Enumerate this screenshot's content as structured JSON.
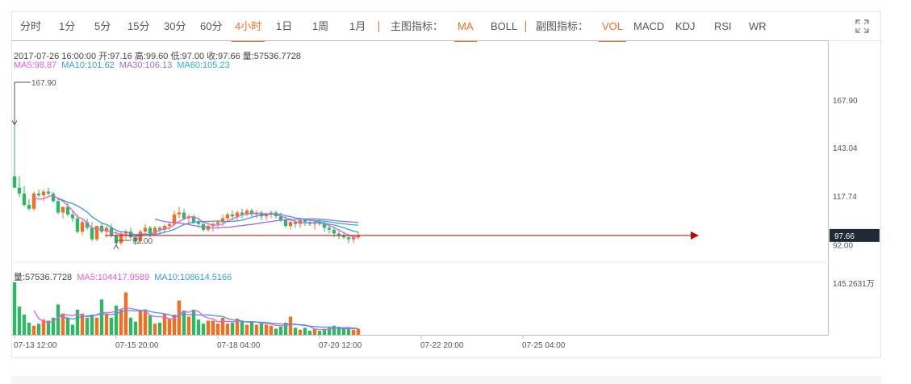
{
  "toolbar": {
    "periods": [
      "分时",
      "1分",
      "5分",
      "15分",
      "30分",
      "60分",
      "4小时",
      "1日",
      "1周",
      "1月"
    ],
    "active_period": "4小时",
    "main_indicator_label": "主图指标：",
    "main_indicators": [
      "MA",
      "BOLL"
    ],
    "active_main": "MA",
    "sub_indicator_label": "副图指标：",
    "sub_indicators": [
      "VOL",
      "MACD",
      "KDJ",
      "RSI",
      "WR"
    ],
    "active_sub": "VOL",
    "expand_icon": "expand-icon"
  },
  "info": {
    "ohlc_line": "2017-07-26 16:00:00  开:97.16  高:99.60  低:97.00  收:97.66  量:57536.7728",
    "ma5": "MA5:98.87",
    "ma10": "MA10:101.62",
    "ma30": "MA30:106.13",
    "ma60": "MA60:105.23",
    "vol": "量:57536.7728",
    "vol_ma5": "MA5:104417.9589",
    "vol_ma10": "MA10:108614.5166"
  },
  "colors": {
    "up": "#f26f21",
    "down": "#2fb766",
    "ma5": "#e55de0",
    "ma10": "#3d9bd7",
    "ma30": "#9a6fdc",
    "ma60": "#27b6c9",
    "price_line": "#cc0000",
    "accent": "#f26f21"
  },
  "chart_data": {
    "type": "candlestick",
    "price_axis_ticks": [
      "167.90",
      "143.04",
      "117.74",
      "92.00"
    ],
    "volume_axis_tick": "145.2631万",
    "x_tick_labels": [
      "07-13 12:00",
      "07-15 20:00",
      "07-18 04:00",
      "07-20 12:00",
      "07-22 20:00",
      "07-25 04:00"
    ],
    "max_label": "167.90",
    "min_label": "92.00",
    "last_price": "97.66",
    "price_range": [
      83.0,
      195.0
    ],
    "volume_max": 145.2631,
    "candles": [
      [
        128,
        155,
        122,
        122,
        52
      ],
      [
        122,
        128,
        117,
        119,
        28
      ],
      [
        119,
        123,
        112,
        113,
        20
      ],
      [
        113,
        116,
        110,
        111,
        12
      ],
      [
        111,
        120,
        110,
        119,
        9
      ],
      [
        119,
        121,
        117,
        118,
        11
      ],
      [
        118,
        121,
        115,
        120,
        15
      ],
      [
        120,
        122,
        118,
        119,
        14
      ],
      [
        119,
        120,
        114,
        115,
        17
      ],
      [
        115,
        117,
        108,
        109,
        30
      ],
      [
        109,
        112,
        106,
        112,
        21
      ],
      [
        112,
        114,
        107,
        108,
        17
      ],
      [
        108,
        110,
        104,
        106,
        10
      ],
      [
        106,
        108,
        98,
        99,
        25
      ],
      [
        99,
        105,
        97,
        104,
        21
      ],
      [
        104,
        106,
        100,
        101,
        17
      ],
      [
        101,
        104,
        94,
        95,
        20
      ],
      [
        95,
        102,
        94,
        102,
        17
      ],
      [
        102,
        104,
        98,
        99,
        35
      ],
      [
        99,
        102,
        96,
        101,
        21
      ],
      [
        101,
        103,
        96,
        97,
        17
      ],
      [
        97,
        99,
        92,
        93,
        29
      ],
      [
        93,
        99,
        92,
        98,
        25
      ],
      [
        98,
        100,
        95,
        99,
        42
      ],
      [
        99,
        101,
        95,
        96,
        17
      ],
      [
        96,
        97,
        92,
        94,
        13
      ],
      [
        94,
        100,
        93,
        99,
        24
      ],
      [
        99,
        103,
        97,
        101,
        24
      ],
      [
        101,
        102,
        96,
        98,
        19
      ],
      [
        98,
        102,
        97,
        101,
        11
      ],
      [
        101,
        102,
        98,
        100,
        12
      ],
      [
        100,
        103,
        98,
        102,
        21
      ],
      [
        102,
        104,
        100,
        103,
        16
      ],
      [
        103,
        110,
        102,
        108,
        20
      ],
      [
        108,
        112,
        106,
        109,
        34
      ],
      [
        109,
        111,
        105,
        106,
        24
      ],
      [
        106,
        108,
        103,
        107,
        18
      ],
      [
        107,
        108,
        103,
        104,
        25
      ],
      [
        104,
        106,
        101,
        103,
        15
      ],
      [
        103,
        104,
        99,
        100,
        11
      ],
      [
        100,
        103,
        99,
        102,
        14
      ],
      [
        102,
        104,
        99,
        103,
        14
      ],
      [
        103,
        105,
        101,
        104,
        11
      ],
      [
        104,
        108,
        102,
        106,
        17
      ],
      [
        106,
        109,
        104,
        108,
        11
      ],
      [
        108,
        110,
        105,
        107,
        12
      ],
      [
        107,
        110,
        105,
        109,
        16
      ],
      [
        109,
        111,
        106,
        108,
        13
      ],
      [
        108,
        111,
        107,
        110,
        10
      ],
      [
        110,
        111,
        107,
        108,
        13
      ],
      [
        108,
        110,
        106,
        109,
        10
      ],
      [
        109,
        110,
        105,
        107,
        12
      ],
      [
        107,
        109,
        105,
        108,
        10
      ],
      [
        108,
        110,
        106,
        109,
        9
      ],
      [
        109,
        110,
        106,
        107,
        6
      ],
      [
        107,
        109,
        104,
        105,
        8
      ],
      [
        105,
        107,
        101,
        102,
        12
      ],
      [
        102,
        106,
        100,
        104,
        18
      ],
      [
        104,
        105,
        101,
        103,
        7
      ],
      [
        103,
        106,
        101,
        105,
        5
      ],
      [
        105,
        106,
        102,
        104,
        7
      ],
      [
        104,
        105,
        102,
        103,
        4
      ],
      [
        103,
        105,
        100,
        104,
        6
      ],
      [
        104,
        106,
        102,
        103,
        4
      ],
      [
        103,
        104,
        99,
        101,
        6
      ],
      [
        101,
        103,
        98,
        100,
        7
      ],
      [
        100,
        101,
        96,
        98,
        9
      ],
      [
        98,
        100,
        95,
        97,
        8
      ],
      [
        97,
        99,
        95,
        96,
        6
      ],
      [
        96,
        97,
        93,
        95,
        6
      ],
      [
        95,
        97,
        93,
        96,
        5
      ],
      [
        96,
        99,
        95,
        97,
        6
      ]
    ]
  }
}
